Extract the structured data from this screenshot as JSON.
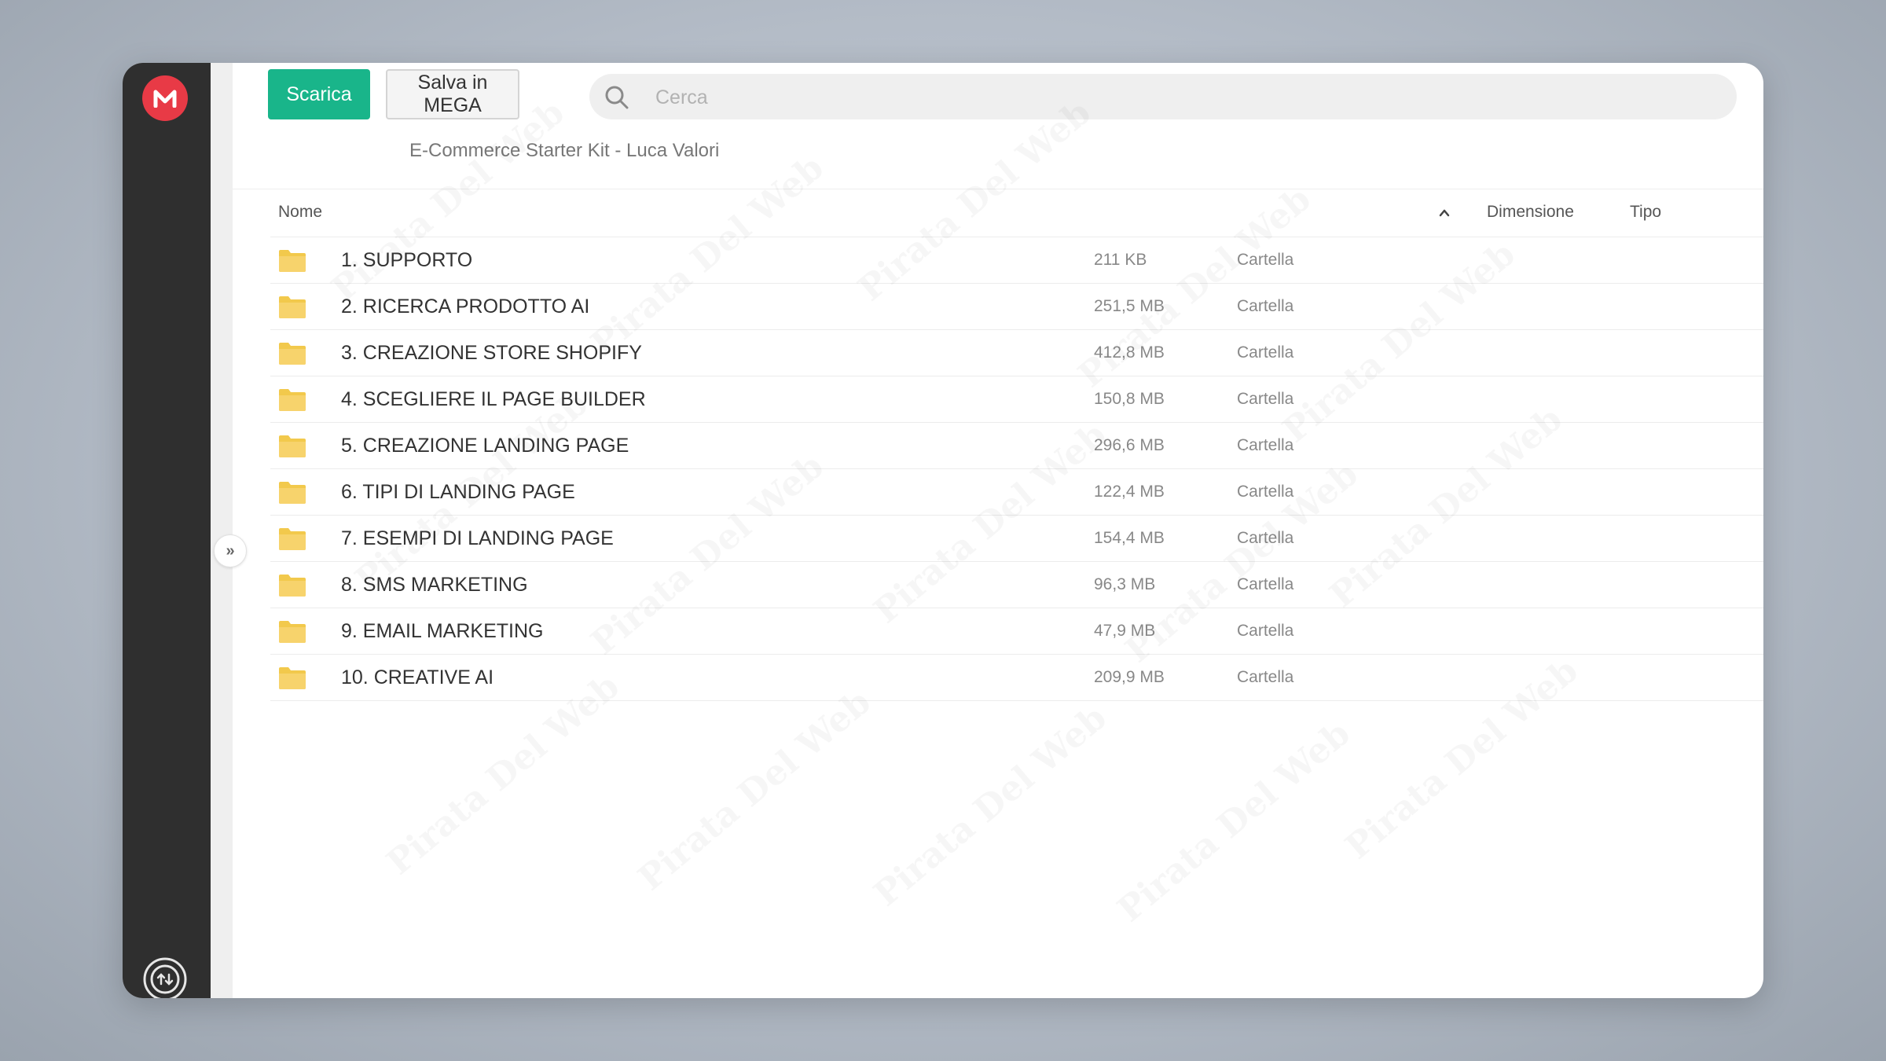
{
  "toolbar": {
    "download_label": "Scarica",
    "save_label": "Salva in MEGA"
  },
  "search": {
    "placeholder": "Cerca",
    "value": ""
  },
  "breadcrumb": "E-Commerce Starter Kit - Luca Valori",
  "table": {
    "headers": {
      "name": "Nome",
      "size": "Dimensione",
      "type": "Tipo"
    },
    "sort": "name-ascending",
    "rows": [
      {
        "name": "1. SUPPORTO",
        "size": "211 KB",
        "type": "Cartella"
      },
      {
        "name": "2. RICERCA PRODOTTO AI",
        "size": "251,5 MB",
        "type": "Cartella"
      },
      {
        "name": "3. CREAZIONE STORE SHOPIFY",
        "size": "412,8 MB",
        "type": "Cartella"
      },
      {
        "name": "4. SCEGLIERE IL PAGE BUILDER",
        "size": "150,8 MB",
        "type": "Cartella"
      },
      {
        "name": "5. CREAZIONE LANDING PAGE",
        "size": "296,6 MB",
        "type": "Cartella"
      },
      {
        "name": "6. TIPI DI LANDING PAGE",
        "size": "122,4 MB",
        "type": "Cartella"
      },
      {
        "name": "7. ESEMPI DI LANDING PAGE",
        "size": "154,4 MB",
        "type": "Cartella"
      },
      {
        "name": "8. SMS MARKETING",
        "size": "96,3 MB",
        "type": "Cartella"
      },
      {
        "name": "9. EMAIL MARKETING",
        "size": "47,9 MB",
        "type": "Cartella"
      },
      {
        "name": "10. CREATIVE AI",
        "size": "209,9 MB",
        "type": "Cartella"
      }
    ]
  },
  "icons": {
    "logo": "mega-logo-icon",
    "expand": "double-chevron-right-icon",
    "search": "search-icon",
    "folder": "folder-icon",
    "sort": "chevron-up-icon",
    "transfer": "transfer-icon"
  },
  "colors": {
    "primary_button": "#19b58a",
    "logo": "#e83a46",
    "sidebar": "#2f2f2f",
    "folder": "#f7d36c"
  },
  "watermark": "Pirata Del Web"
}
